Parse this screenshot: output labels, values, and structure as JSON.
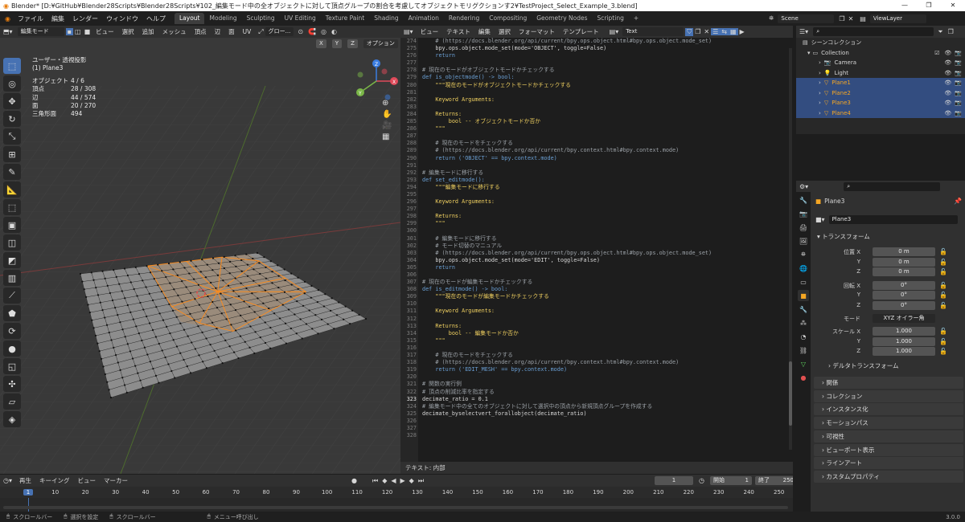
{
  "window": {
    "title": "Blender* [D:¥GitHub¥Blender28Scripts¥Blender28Scripts¥102_編集モード中の全オブジェクトに対して頂点グループの割合を考慮してオブジェクトモリグクションす2¥TestProject_Select_Example_3.blend]",
    "min": "—",
    "max": "❐",
    "close": "✕"
  },
  "menubar": {
    "menus": [
      "ファイル",
      "編集",
      "レンダー",
      "ウィンドウ",
      "ヘルプ"
    ],
    "tabs": [
      "Layout",
      "Modeling",
      "Sculpting",
      "UV Editing",
      "Texture Paint",
      "Shading",
      "Animation",
      "Rendering",
      "Compositing",
      "Geometry Nodes",
      "Scripting"
    ],
    "active_tab": "Layout",
    "add_tab": "+",
    "scene": "Scene",
    "viewlayer": "ViewLayer"
  },
  "viewport": {
    "mode": "編集モード",
    "menus": [
      "ビュー",
      "選択",
      "追加",
      "メッシュ",
      "頂点",
      "辺",
      "面",
      "UV"
    ],
    "orientation": "グロー...",
    "options": "オプション",
    "axes": [
      "X",
      "Y",
      "Z"
    ],
    "stats": {
      "view_name": "ユーザー・透視投影",
      "object_name": "(1) Plane3",
      "rows": [
        {
          "k": "オブジェクト",
          "v": "4 / 6"
        },
        {
          "k": "頂点",
          "v": "28 / 308"
        },
        {
          "k": "辺",
          "v": "44 / 574"
        },
        {
          "k": "面",
          "v": "20 / 270"
        },
        {
          "k": "三角形面",
          "v": "494"
        }
      ]
    }
  },
  "text_editor": {
    "menus": [
      "ビュー",
      "テキスト",
      "編集",
      "選択",
      "フォーマット",
      "テンプレート"
    ],
    "text_name": "Text",
    "footer": "テキスト: 内部",
    "current_line": "323",
    "lines": [
      {
        "n": "274",
        "t": "    # (https://docs.blender.org/api/current/bpy.ops.object.html#bpy.ops.object.mode_set)"
      },
      {
        "n": "275",
        "t": "    bpy.ops.object.mode_set(mode='OBJECT', toggle=False)"
      },
      {
        "n": "276",
        "t": "    return"
      },
      {
        "n": "277",
        "t": ""
      },
      {
        "n": "278",
        "t": "# 現在のモードがオブジェクトモードかチェックする"
      },
      {
        "n": "279",
        "t": "def is_objectmode() -> bool:"
      },
      {
        "n": "280",
        "t": "    \"\"\"現在のモードがオブジェクトモードかチェックする"
      },
      {
        "n": "281",
        "t": ""
      },
      {
        "n": "282",
        "t": "    Keyword Arguments:"
      },
      {
        "n": "283",
        "t": ""
      },
      {
        "n": "284",
        "t": "    Returns:"
      },
      {
        "n": "285",
        "t": "        bool -- オブジェクトモードか否か"
      },
      {
        "n": "286",
        "t": "    \"\"\""
      },
      {
        "n": "287",
        "t": ""
      },
      {
        "n": "288",
        "t": "    # 現在のモードをチェックする"
      },
      {
        "n": "289",
        "t": "    # (https://docs.blender.org/api/current/bpy.context.html#bpy.context.mode)"
      },
      {
        "n": "290",
        "t": "    return ('OBJECT' == bpy.context.mode)"
      },
      {
        "n": "291",
        "t": ""
      },
      {
        "n": "292",
        "t": "# 編集モードに移行する"
      },
      {
        "n": "293",
        "t": "def set_editmode():"
      },
      {
        "n": "294",
        "t": "    \"\"\"編集モードに移行する"
      },
      {
        "n": "295",
        "t": ""
      },
      {
        "n": "296",
        "t": "    Keyword Arguments:"
      },
      {
        "n": "297",
        "t": ""
      },
      {
        "n": "298",
        "t": "    Returns:"
      },
      {
        "n": "299",
        "t": "    \"\"\""
      },
      {
        "n": "300",
        "t": ""
      },
      {
        "n": "301",
        "t": "    # 編集モードに移行する"
      },
      {
        "n": "302",
        "t": "    # モード切替のマニュアル"
      },
      {
        "n": "303",
        "t": "    # (https://docs.blender.org/api/current/bpy.ops.object.html#bpy.ops.object.mode_set)"
      },
      {
        "n": "304",
        "t": "    bpy.ops.object.mode_set(mode='EDIT', toggle=False)"
      },
      {
        "n": "305",
        "t": "    return"
      },
      {
        "n": "306",
        "t": ""
      },
      {
        "n": "307",
        "t": "# 現在のモードが編集モードかチェックする"
      },
      {
        "n": "308",
        "t": "def is_editmode() -> bool:"
      },
      {
        "n": "309",
        "t": "    \"\"\"現在のモードが編集モードかチェックする"
      },
      {
        "n": "310",
        "t": ""
      },
      {
        "n": "311",
        "t": "    Keyword Arguments:"
      },
      {
        "n": "312",
        "t": ""
      },
      {
        "n": "313",
        "t": "    Returns:"
      },
      {
        "n": "314",
        "t": "        bool -- 編集モードか否か"
      },
      {
        "n": "315",
        "t": "    \"\"\""
      },
      {
        "n": "316",
        "t": ""
      },
      {
        "n": "317",
        "t": "    # 現在のモードをチェックする"
      },
      {
        "n": "318",
        "t": "    # (https://docs.blender.org/api/current/bpy.context.html#bpy.context.mode)"
      },
      {
        "n": "319",
        "t": "    return ('EDIT_MESH' == bpy.context.mode)"
      },
      {
        "n": "320",
        "t": ""
      },
      {
        "n": "321",
        "t": "# 関数の実行例"
      },
      {
        "n": "322",
        "t": "# 頂点の削減比率を指定する"
      },
      {
        "n": "323",
        "t": "decimate_ratio = 0.1"
      },
      {
        "n": "324",
        "t": "# 編集モード中の全てのオブジェクトに対して選択中の頂点から新規頂点グループを作成する"
      },
      {
        "n": "325",
        "t": "decimate_byselectvert_forallobject(decimate_ratio)"
      },
      {
        "n": "326",
        "t": ""
      },
      {
        "n": "327",
        "t": ""
      },
      {
        "n": "328",
        "t": ""
      }
    ]
  },
  "outliner": {
    "root": "シーンコレクション",
    "collection": "Collection",
    "items": [
      {
        "name": "Camera",
        "selected": false
      },
      {
        "name": "Light",
        "selected": false
      },
      {
        "name": "Plane1",
        "selected": true
      },
      {
        "name": "Plane2",
        "selected": true
      },
      {
        "name": "Plane3",
        "selected": true
      },
      {
        "name": "Plane4",
        "selected": true
      }
    ]
  },
  "properties": {
    "object_name": "Plane3",
    "object_field": "Plane3",
    "transform_panel": "トランスフォーム",
    "location_label": "位置 X",
    "rotation_label": "回転 X",
    "scale_label": "スケール X",
    "y": "Y",
    "z": "Z",
    "location": [
      "0 m",
      "0 m",
      "0 m"
    ],
    "rotation": [
      "0°",
      "0°",
      "0°"
    ],
    "scale": [
      "1.000",
      "1.000",
      "1.000"
    ],
    "mode_label": "モード",
    "mode_value": "XYZ オイラー角",
    "delta": "デルタトランスフォーム",
    "panels": [
      "関係",
      "コレクション",
      "インスタンス化",
      "モーションパス",
      "可視性",
      "ビューポート表示",
      "ラインアート",
      "カスタムプロパティ"
    ]
  },
  "timeline": {
    "menus": [
      "再生",
      "キーイング",
      "ビュー",
      "マーカー"
    ],
    "current_frame": "1",
    "start_label": "開始",
    "start": "1",
    "end_label": "終了",
    "end": "250",
    "ticks": [
      "1",
      "10",
      "20",
      "30",
      "40",
      "50",
      "60",
      "70",
      "80",
      "90",
      "100",
      "110",
      "120",
      "130",
      "140",
      "150",
      "160",
      "170",
      "180",
      "190",
      "200",
      "210",
      "220",
      "230",
      "240",
      "250"
    ]
  },
  "statusbar": {
    "items": [
      "スクロールバー",
      "選択を設定",
      "スクロールバー",
      "メニュー呼び出し"
    ],
    "version": "3.0.0"
  },
  "colors": {
    "accent": "#4772b3",
    "selected_row": "#334d80",
    "mesh_selected": "#ff8c1a",
    "keyword": "#6a9fd4",
    "string": "#f0d060",
    "comment": "#9aa0a6"
  }
}
